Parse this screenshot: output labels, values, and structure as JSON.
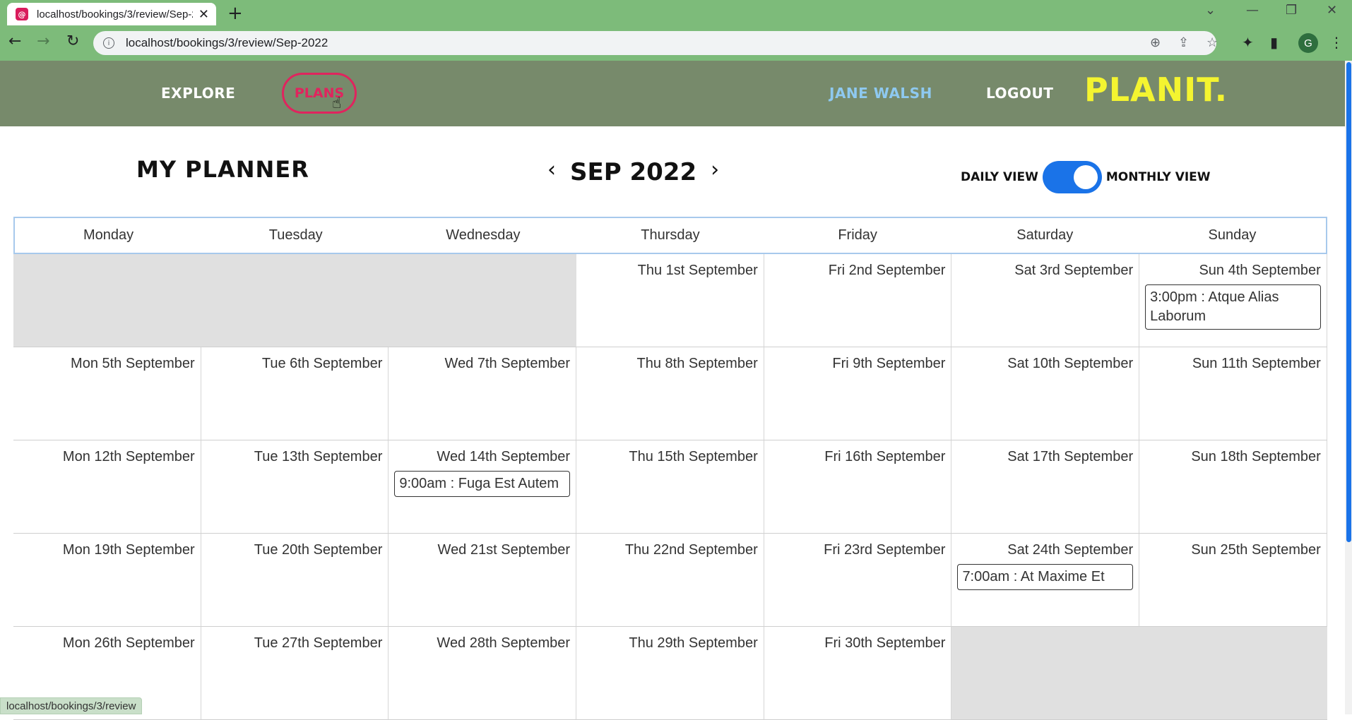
{
  "browser": {
    "tab_title": "localhost/bookings/3/review/Sep-2022",
    "url": "localhost/bookings/3/review/Sep-2022",
    "status_url": "localhost/bookings/3/review",
    "profile_initial": "G"
  },
  "header": {
    "nav": {
      "explore": "EXPLORE",
      "plans": "PLANS",
      "user": "JANE WALSH",
      "logout": "LOGOUT"
    },
    "logo": "PLANIT."
  },
  "planner": {
    "title": "MY PLANNER",
    "month": "SEP 2022",
    "toggle": {
      "left": "DAILY VIEW",
      "right": "MONTHLY VIEW",
      "active": "monthly"
    }
  },
  "calendar": {
    "weekdays": [
      "Monday",
      "Tuesday",
      "Wednesday",
      "Thursday",
      "Friday",
      "Saturday",
      "Sunday"
    ],
    "leading_empty": 3,
    "trailing_empty": 2,
    "days": [
      {
        "label": "Thu 1st September"
      },
      {
        "label": "Fri 2nd September"
      },
      {
        "label": "Sat 3rd September"
      },
      {
        "label": "Sun 4th September",
        "event": "3:00pm : Atque Alias Laborum"
      },
      {
        "label": "Mon 5th September"
      },
      {
        "label": "Tue 6th September"
      },
      {
        "label": "Wed 7th September"
      },
      {
        "label": "Thu 8th September"
      },
      {
        "label": "Fri 9th September"
      },
      {
        "label": "Sat 10th September"
      },
      {
        "label": "Sun 11th September"
      },
      {
        "label": "Mon 12th September"
      },
      {
        "label": "Tue 13th September"
      },
      {
        "label": "Wed 14th September",
        "event": "9:00am : Fuga Est Autem"
      },
      {
        "label": "Thu 15th September"
      },
      {
        "label": "Fri 16th September"
      },
      {
        "label": "Sat 17th September"
      },
      {
        "label": "Sun 18th September"
      },
      {
        "label": "Mon 19th September"
      },
      {
        "label": "Tue 20th September"
      },
      {
        "label": "Wed 21st September"
      },
      {
        "label": "Thu 22nd September"
      },
      {
        "label": "Fri 23rd September"
      },
      {
        "label": "Sat 24th September",
        "event": "7:00am : At Maxime Et"
      },
      {
        "label": "Sun 25th September"
      },
      {
        "label": "Mon 26th September"
      },
      {
        "label": "Tue 27th September"
      },
      {
        "label": "Wed 28th September"
      },
      {
        "label": "Thu 29th September"
      },
      {
        "label": "Fri 30th September"
      }
    ]
  },
  "colors": {
    "header_bg": "#778a6b",
    "accent": "#e0245e",
    "logo": "#f4f430",
    "toggle": "#1a73e8",
    "user": "#8ec9f0"
  }
}
